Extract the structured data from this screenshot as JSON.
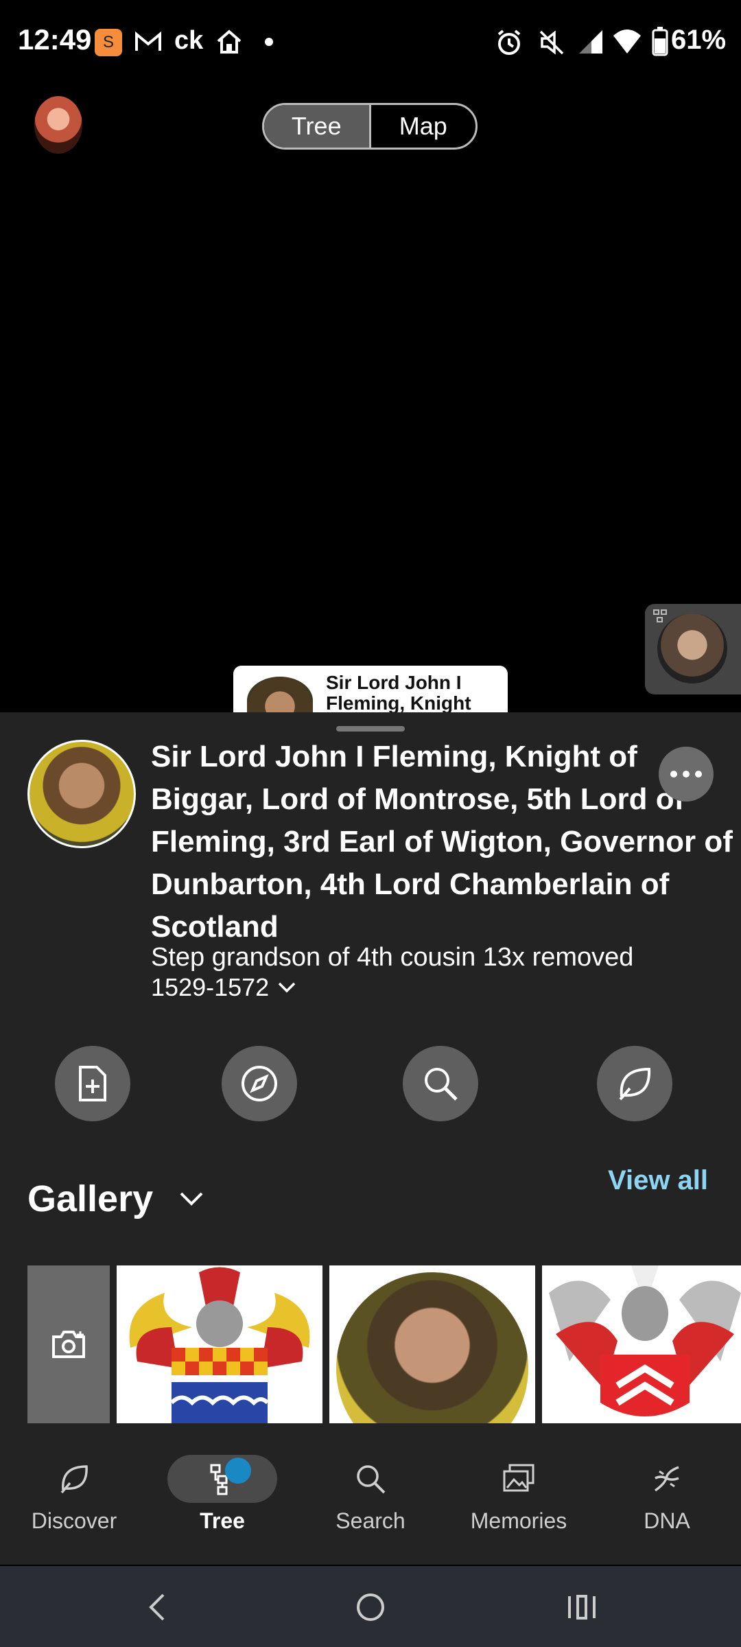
{
  "status_bar": {
    "time": "12:49",
    "badge": "S",
    "carrier": "ck",
    "battery": "61%"
  },
  "top_toggle": {
    "tree": "Tree",
    "map": "Map",
    "active": "Tree"
  },
  "tree_canvas": {
    "node_main_label": "Sir Lord John I Fleming, Knight"
  },
  "person": {
    "name": "Sir Lord John I Fleming, Knight of Biggar, Lord of Montrose, 5th Lord of Fleming, 3rd Earl of Wigton, Governor of Dunbarton, 4th Lord Chamberlain of Scotland",
    "relationship": "Step grandson of 4th cousin 13x removed",
    "lifespan": "1529-1572"
  },
  "actions": [
    {
      "icon": "add-document-icon"
    },
    {
      "icon": "compass-icon"
    },
    {
      "icon": "search-icon"
    },
    {
      "icon": "leaf-icon"
    }
  ],
  "gallery": {
    "title": "Gallery",
    "view_all": "View all"
  },
  "bottom_nav": [
    {
      "label": "Discover",
      "icon": "leaf-icon"
    },
    {
      "label": "Tree",
      "icon": "tree-icon",
      "active": true
    },
    {
      "label": "Search",
      "icon": "search-icon"
    },
    {
      "label": "Memories",
      "icon": "photos-icon"
    },
    {
      "label": "DNA",
      "icon": "dna-icon"
    }
  ],
  "colors": {
    "accent_link": "#8fd4f2",
    "sheet_bg": "#232323",
    "notify_dot": "#1a88c3"
  }
}
